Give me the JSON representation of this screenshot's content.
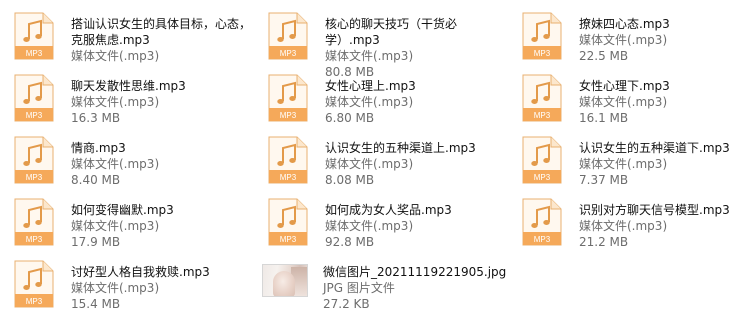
{
  "files": [
    {
      "name": "搭讪认识女生的具体目标，心态，\n克服焦虑.mp3",
      "type": "媒体文件(.mp3)",
      "size": "",
      "icon": "mp3-file-icon",
      "icon_label": "MP3"
    },
    {
      "name": "核心的聊天技巧（干货必学）.mp3",
      "type": "媒体文件(.mp3)",
      "size": "80.8 MB",
      "icon": "mp3-file-icon",
      "icon_label": "MP3"
    },
    {
      "name": "撩妹四心态.mp3",
      "type": "媒体文件(.mp3)",
      "size": "22.5 MB",
      "icon": "mp3-file-icon",
      "icon_label": "MP3"
    },
    {
      "name": "聊天发散性思维.mp3",
      "type": "媒体文件(.mp3)",
      "size": "16.3 MB",
      "icon": "mp3-file-icon",
      "icon_label": "MP3"
    },
    {
      "name": "女性心理上.mp3",
      "type": "媒体文件(.mp3)",
      "size": "6.80 MB",
      "icon": "mp3-file-icon",
      "icon_label": "MP3"
    },
    {
      "name": "女性心理下.mp3",
      "type": "媒体文件(.mp3)",
      "size": "16.1 MB",
      "icon": "mp3-file-icon",
      "icon_label": "MP3"
    },
    {
      "name": "情商.mp3",
      "type": "媒体文件(.mp3)",
      "size": "8.40 MB",
      "icon": "mp3-file-icon",
      "icon_label": "MP3"
    },
    {
      "name": "认识女生的五种渠道上.mp3",
      "type": "媒体文件(.mp3)",
      "size": "8.08 MB",
      "icon": "mp3-file-icon",
      "icon_label": "MP3"
    },
    {
      "name": "认识女生的五种渠道下.mp3",
      "type": "媒体文件(.mp3)",
      "size": "7.37 MB",
      "icon": "mp3-file-icon",
      "icon_label": "MP3"
    },
    {
      "name": "如何变得幽默.mp3",
      "type": "媒体文件(.mp3)",
      "size": "17.9 MB",
      "icon": "mp3-file-icon",
      "icon_label": "MP3"
    },
    {
      "name": "如何成为女人奖品.mp3",
      "type": "媒体文件(.mp3)",
      "size": "92.8 MB",
      "icon": "mp3-file-icon",
      "icon_label": "MP3"
    },
    {
      "name": "识别对方聊天信号模型.mp3",
      "type": "媒体文件(.mp3)",
      "size": "21.2 MB",
      "icon": "mp3-file-icon",
      "icon_label": "MP3"
    },
    {
      "name": "讨好型人格自我救赎.mp3",
      "type": "媒体文件(.mp3)",
      "size": "15.4 MB",
      "icon": "mp3-file-icon",
      "icon_label": "MP3"
    },
    {
      "name": "微信图片_20211119221905.jpg",
      "type": "JPG 图片文件",
      "size": "27.2 KB",
      "icon": "jpg-thumbnail-icon",
      "icon_label": ""
    }
  ]
}
